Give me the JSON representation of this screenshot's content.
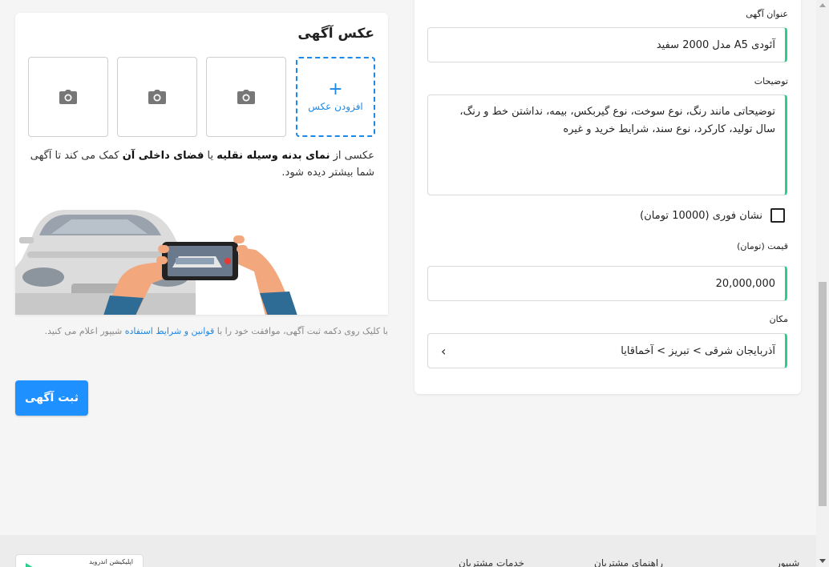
{
  "form": {
    "title_label": "عنوان آگهی",
    "title_value": "آئودی A5 مدل 2000 سفید",
    "description_label": "توضیحات",
    "description_placeholder": "توضیحاتی مانند رنگ، نوع سوخت، نوع گیربکس، بیمه، نداشتن خط و رنگ، سال تولید، کارکرد، نوع سند، شرایط خرید و غیره",
    "urgent_label": "نشان فوری (10000 تومان)",
    "urgent_checked": false,
    "price_label": "قیمت (تومان)",
    "price_value": "20,000,000",
    "location_label": "مکان",
    "location_value": "آذربایجان شرقی > تبریز > آخماقایا"
  },
  "photos": {
    "title": "عکس آگهی",
    "add_label": "افزودن عکس",
    "desc_part1": "عکسی از ",
    "desc_bold1": "نمای بدنه وسیله نقلیه",
    "desc_part2": " یا ",
    "desc_bold2": "فضای داخلی آن",
    "desc_part3": " کمک می کند تا آگهی شما بیشتر دیده شود."
  },
  "terms": {
    "part1": "با کلیک روی دکمه ثبت آگهی، موافقت خود را با ",
    "link": "قوانین و شرایط استفاده",
    "part2": " شیپور اعلام می کنید."
  },
  "submit_label": "ثبت آگهی",
  "footer": {
    "brand": "شیپور",
    "customer_guide": "راهنمای مشتریان",
    "customer_services": "خدمات مشتریان",
    "android_app": "اپلیکیشن اندروید"
  },
  "colors": {
    "accent": "#1e90ff",
    "field_accent": "#2bcf8b"
  }
}
